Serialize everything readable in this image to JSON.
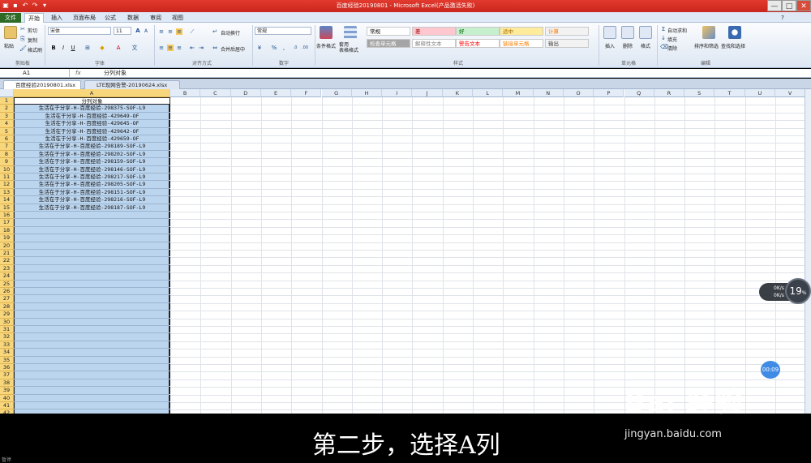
{
  "window": {
    "title": "百度经验20190801 - Microsoft Excel(产品激活失败)",
    "minimize": "—",
    "restore": "□",
    "close": "✕"
  },
  "ribbon_tabs": [
    "文件",
    "开始",
    "插入",
    "页面布局",
    "公式",
    "数据",
    "审阅",
    "视图"
  ],
  "clipboard": {
    "paste": "粘贴",
    "cut": "剪切",
    "copy": "复制",
    "format_painter": "格式刷",
    "label": "剪贴板"
  },
  "font": {
    "name": "宋体",
    "size": "11",
    "bold": "B",
    "italic": "I",
    "underline": "U",
    "label": "字体"
  },
  "alignment": {
    "wrap": "自动换行",
    "merge": "合并后居中",
    "label": "对齐方式"
  },
  "number": {
    "format": "常规",
    "percent": "%",
    "label": "数字"
  },
  "styles": {
    "conditional": "条件格式",
    "table": "套用\n表格格式",
    "cells": [
      {
        "text": "常规",
        "bg": "#ffffff",
        "fg": "#000000"
      },
      {
        "text": "差",
        "bg": "#ffc7ce",
        "fg": "#9c0006"
      },
      {
        "text": "好",
        "bg": "#c6efce",
        "fg": "#006100"
      },
      {
        "text": "适中",
        "bg": "#ffeb9c",
        "fg": "#9c6500"
      },
      {
        "text": "计算",
        "bg": "#f2f2f2",
        "fg": "#fa7d00"
      },
      {
        "text": "检查单元格",
        "bg": "#a5a5a5",
        "fg": "#ffffff"
      },
      {
        "text": "解释性文本",
        "bg": "#ffffff",
        "fg": "#7f7f7f"
      },
      {
        "text": "警告文本",
        "bg": "#ffffff",
        "fg": "#ff0000"
      },
      {
        "text": "链接单元格",
        "bg": "#ffffff",
        "fg": "#fa7d00"
      },
      {
        "text": "输出",
        "bg": "#f2f2f2",
        "fg": "#3f3f3f"
      }
    ],
    "label": "样式"
  },
  "cells_group": {
    "insert": "插入",
    "delete": "删除",
    "format": "格式",
    "label": "单元格"
  },
  "editing": {
    "autosum": "自动求和",
    "fill": "填充",
    "clear": "清除",
    "sort": "排序和筛选",
    "find": "查找和选择",
    "label": "编辑"
  },
  "formula_bar": {
    "name_box": "A1",
    "fx": "fx",
    "content": "分列对象"
  },
  "workbooks": [
    {
      "name": "百度经验20190801.xlsx",
      "active": true
    },
    {
      "name": "LTE现网告警-20190624.xlsx",
      "active": false
    }
  ],
  "columns": [
    "A",
    "B",
    "C",
    "D",
    "E",
    "F",
    "G",
    "H",
    "I",
    "J",
    "K",
    "L",
    "M",
    "N",
    "O",
    "P",
    "Q",
    "R",
    "S",
    "T",
    "U",
    "V"
  ],
  "rows": [
    "1",
    "2",
    "3",
    "4",
    "5",
    "6",
    "7",
    "8",
    "9",
    "10",
    "11",
    "12",
    "13",
    "14",
    "15",
    "16",
    "17",
    "18",
    "19",
    "20",
    "21",
    "22",
    "23",
    "24",
    "25",
    "26",
    "27",
    "28",
    "29",
    "30",
    "31",
    "32",
    "33",
    "34",
    "35",
    "36",
    "37",
    "38",
    "39",
    "40",
    "41",
    "42"
  ],
  "column_a": [
    "分列对象",
    "生活在于分享-H-百度经验-298375-SOF-L9",
    "生活在于分享-H-百度经验-429649-OF",
    "生活在于分享-H-百度经验-429645-OF",
    "生活在于分享-H-百度经验-429642-OF",
    "生活在于分享-H-百度经验-429659-OF",
    "生活在于分享-H-百度经验-298189-SOF-L9",
    "生活在于分享-H-百度经验-298202-SOF-L9",
    "生活在于分享-H-百度经验-298159-SOF-L9",
    "生活在于分享-H-百度经验-298146-SOF-L9",
    "生活在于分享-H-百度经验-298217-SOF-L9",
    "生活在于分享-H-百度经验-298205-SOF-L9",
    "生活在于分享-H-百度经验-298151-SOF-L9",
    "生活在于分享-H-百度经验-298216-SOF-L9",
    "生活在于分享-H-百度经验-298187-SOF-L9"
  ],
  "overlay": {
    "subtitle": "第二步，选择A列",
    "watermark": "Bai  经验",
    "watermark_url": "jingyan.baidu.com",
    "speed_value": "19",
    "speed_unit": "%",
    "speed_up": "0",
    "speed_up_unit": "K/s",
    "speed_down": "0",
    "speed_down_unit": "K/s",
    "timer": "00:09",
    "pause": "暂停"
  }
}
